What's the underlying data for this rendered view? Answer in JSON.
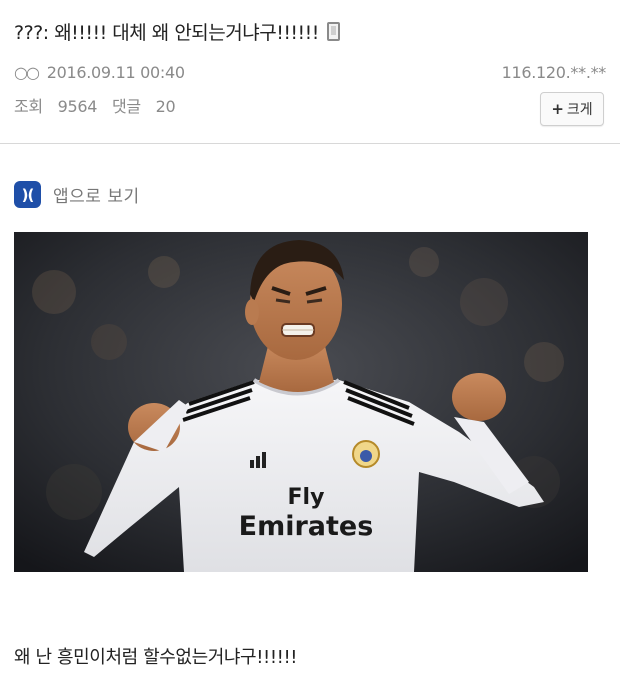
{
  "post": {
    "title": "???: 왜!!!!! 대체 왜 안되는거냐구!!!!!!",
    "nick_icon": "○○",
    "datetime": "2016.09.11 00:40",
    "ip": "116.120.**.**",
    "views_label": "조회",
    "views": "9564",
    "comments_label": "댓글",
    "comments": "20",
    "size_button": "크게",
    "size_button_icon": "+",
    "app_icon_text": ")(",
    "app_link": "앱으로 보기",
    "body_text": "왜 난 흥민이처럼 할수없는거냐구!!!!!!",
    "jersey_text_line1": "Fly",
    "jersey_text_line2": "Emirates",
    "icons": [
      "mobile-icon",
      "app-logo-icon",
      "plus-icon"
    ],
    "colors": {
      "app_icon": "#1f4fa8",
      "meta_text": "#8a8a8a"
    }
  }
}
